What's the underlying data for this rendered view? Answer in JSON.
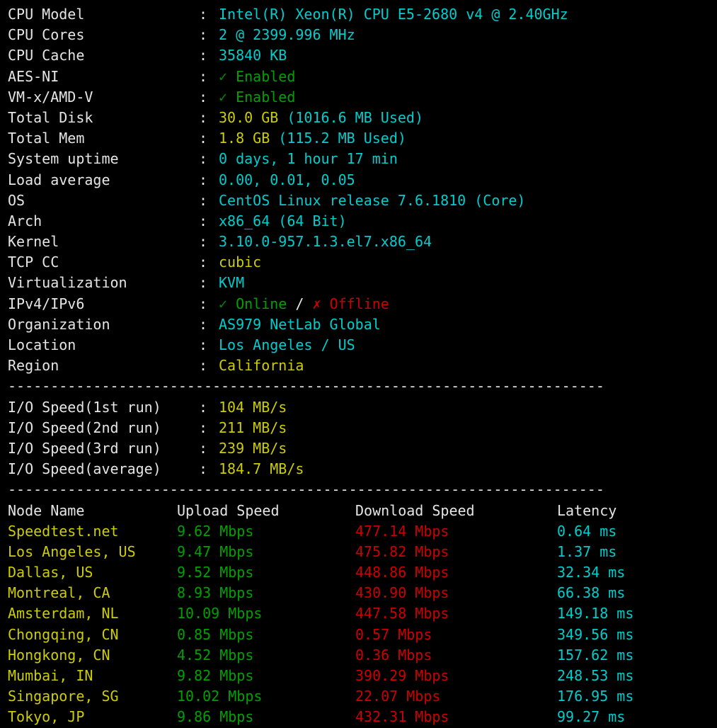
{
  "terminal": {
    "background_color": "#000000",
    "default_text_color": "#e5e5e5",
    "accent_colors": {
      "cyan": "#00cdcd",
      "green": "#00a000",
      "yellow": "#cdcd00",
      "red": "#cd0000",
      "white": "#e5e5e5"
    },
    "separator": "----------------------------------------------------------------------"
  },
  "system_info": {
    "rows": [
      {
        "label": "CPU Model",
        "separator": ":",
        "value": "Intel(R) Xeon(R) CPU E5-2680 v4 @ 2.40GHz",
        "value_color": "cyan"
      },
      {
        "label": "CPU Cores",
        "separator": ":",
        "value": "2 @ 2399.996 MHz",
        "value_color": "cyan"
      },
      {
        "label": "CPU Cache",
        "separator": ":",
        "value": "35840 KB",
        "value_color": "cyan"
      },
      {
        "label": "AES-NI",
        "separator": ":",
        "icon": "check-icon",
        "icon_glyph": "✓",
        "value": "Enabled",
        "value_color": "green"
      },
      {
        "label": "VM-x/AMD-V",
        "separator": ":",
        "icon": "check-icon",
        "icon_glyph": "✓",
        "value": "Enabled",
        "value_color": "green"
      },
      {
        "label": "Total Disk",
        "separator": ":",
        "value_primary": "30.0 GB",
        "value_secondary": "(1016.6 MB Used)",
        "value_color": "yellow"
      },
      {
        "label": "Total Mem",
        "separator": ":",
        "value_primary": "1.8 GB",
        "value_secondary": "(115.2 MB Used)",
        "value_color": "yellow"
      },
      {
        "label": "System uptime",
        "separator": ":",
        "value": "0 days, 1 hour 17 min",
        "value_color": "cyan"
      },
      {
        "label": "Load average",
        "separator": ":",
        "value": "0.00, 0.01, 0.05",
        "value_color": "cyan"
      },
      {
        "label": "OS",
        "separator": ":",
        "value": "CentOS Linux release 7.6.1810 (Core)",
        "value_color": "cyan"
      },
      {
        "label": "Arch",
        "separator": ":",
        "value": "x86_64 (64 Bit)",
        "value_color": "cyan"
      },
      {
        "label": "Kernel",
        "separator": ":",
        "value": "3.10.0-957.1.3.el7.x86_64",
        "value_color": "cyan"
      },
      {
        "label": "TCP CC",
        "separator": ":",
        "value": "cubic",
        "value_color": "yellow"
      },
      {
        "label": "Virtualization",
        "separator": ":",
        "value": "KVM",
        "value_color": "cyan"
      },
      {
        "label": "IPv4/IPv6",
        "separator": ":",
        "ipv4_icon": "check-icon",
        "ipv4_icon_glyph": "✓",
        "ipv4_status": "Online",
        "divider": "/",
        "ipv6_icon": "cross-icon",
        "ipv6_icon_glyph": "✗",
        "ipv6_status": "Offline"
      },
      {
        "label": "Organization",
        "separator": ":",
        "value": "AS979 NetLab Global",
        "value_color": "cyan"
      },
      {
        "label": "Location",
        "separator": ":",
        "value": "Los Angeles / US",
        "value_color": "cyan"
      },
      {
        "label": "Region",
        "separator": ":",
        "value": "California",
        "value_color": "yellow"
      }
    ]
  },
  "io_speed": {
    "rows": [
      {
        "label": "I/O Speed(1st run)",
        "separator": ":",
        "value": "104 MB/s",
        "value_color": "yellow"
      },
      {
        "label": "I/O Speed(2nd run)",
        "separator": ":",
        "value": "211 MB/s",
        "value_color": "yellow"
      },
      {
        "label": "I/O Speed(3rd run)",
        "separator": ":",
        "value": "239 MB/s",
        "value_color": "yellow"
      },
      {
        "label": "I/O Speed(average)",
        "separator": ":",
        "value": "184.7 MB/s",
        "value_color": "yellow"
      }
    ]
  },
  "speedtest": {
    "columns": [
      "Node Name",
      "Upload Speed",
      "Download Speed",
      "Latency"
    ],
    "rows": [
      {
        "node": "Speedtest.net",
        "upload": "9.62 Mbps",
        "download": "477.14 Mbps",
        "latency": "0.64 ms"
      },
      {
        "node": "Los Angeles, US",
        "upload": "9.47 Mbps",
        "download": "475.82 Mbps",
        "latency": "1.37 ms"
      },
      {
        "node": "Dallas, US",
        "upload": "9.52 Mbps",
        "download": "448.86 Mbps",
        "latency": "32.34 ms"
      },
      {
        "node": "Montreal, CA",
        "upload": "8.93 Mbps",
        "download": "430.90 Mbps",
        "latency": "66.38 ms"
      },
      {
        "node": "Amsterdam, NL",
        "upload": "10.09 Mbps",
        "download": "447.58 Mbps",
        "latency": "149.18 ms"
      },
      {
        "node": "Chongqing, CN",
        "upload": "0.85 Mbps",
        "download": "0.57 Mbps",
        "latency": "349.56 ms"
      },
      {
        "node": "Hongkong, CN",
        "upload": "4.52 Mbps",
        "download": "0.36 Mbps",
        "latency": "157.62 ms"
      },
      {
        "node": "Mumbai, IN",
        "upload": "9.82 Mbps",
        "download": "390.29 Mbps",
        "latency": "248.53 ms"
      },
      {
        "node": "Singapore, SG",
        "upload": "10.02 Mbps",
        "download": "22.07 Mbps",
        "latency": "176.95 ms"
      },
      {
        "node": "Tokyo, JP",
        "upload": "9.86 Mbps",
        "download": "432.31 Mbps",
        "latency": "99.27 ms"
      }
    ]
  }
}
